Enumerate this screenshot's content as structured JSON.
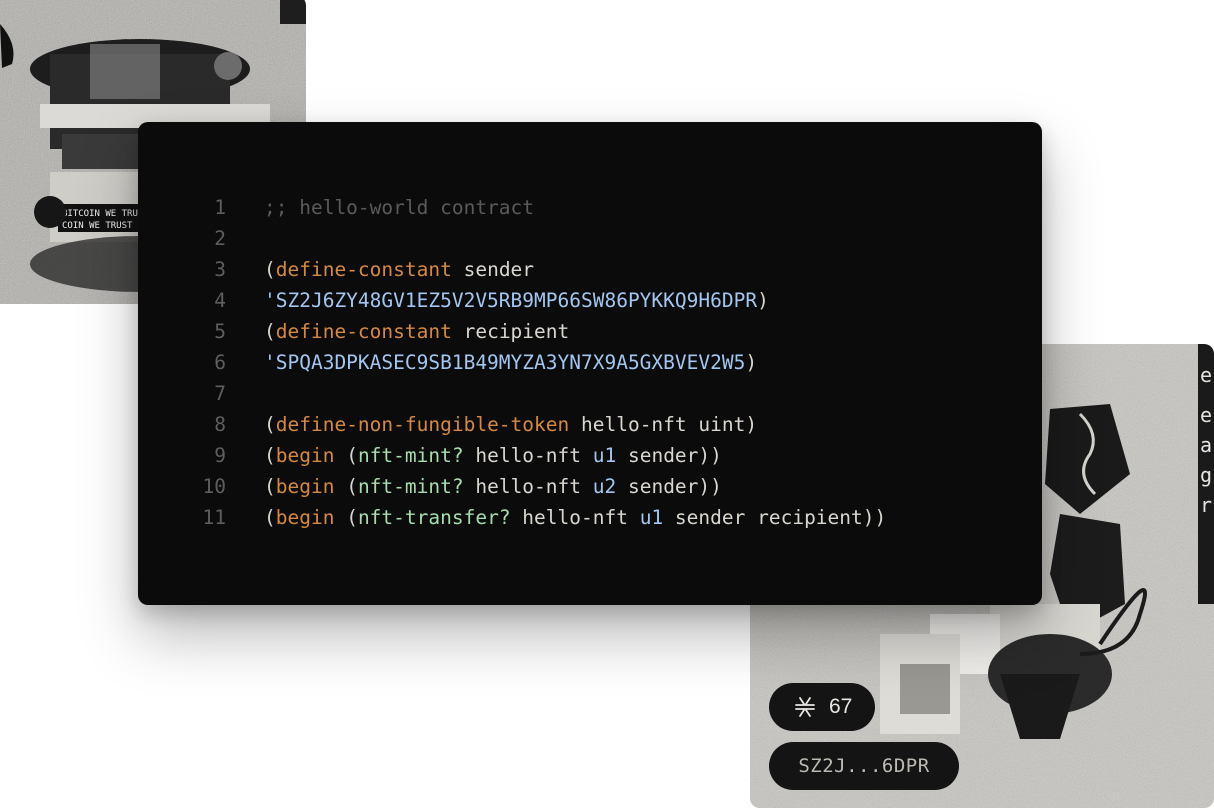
{
  "colors": {
    "background": "#ffffff",
    "code_background": "#0b0b0b",
    "line_number": "#5e5e5e",
    "comment": "#5a5a5a",
    "paren": "#d9d6cf",
    "keyword": "#d5893f",
    "function": "#a6dcae",
    "principal": "#a3c6f0",
    "plain": "#d9d6cf"
  },
  "code": {
    "lines": [
      {
        "n": "1",
        "tokens": [
          {
            "t": ";; hello-world contract",
            "c": "comment"
          }
        ]
      },
      {
        "n": "2",
        "tokens": []
      },
      {
        "n": "3",
        "tokens": [
          {
            "t": "(",
            "c": "paren"
          },
          {
            "t": "define-constant",
            "c": "keyword"
          },
          {
            "t": " sender",
            "c": "plain"
          }
        ]
      },
      {
        "n": "4",
        "tokens": [
          {
            "t": "'SZ2J6ZY48GV1EZ5V2V5RB9MP66SW86PYKKQ9H6DPR",
            "c": "principal"
          },
          {
            "t": ")",
            "c": "paren"
          }
        ]
      },
      {
        "n": "5",
        "tokens": [
          {
            "t": "(",
            "c": "paren"
          },
          {
            "t": "define-constant",
            "c": "keyword"
          },
          {
            "t": " recipient",
            "c": "plain"
          }
        ]
      },
      {
        "n": "6",
        "tokens": [
          {
            "t": "'SPQA3DPKASEC9SB1B49MYZA3YN7X9A5GXBVEV2W5",
            "c": "principal"
          },
          {
            "t": ")",
            "c": "paren"
          }
        ]
      },
      {
        "n": "7",
        "tokens": []
      },
      {
        "n": "8",
        "tokens": [
          {
            "t": "(",
            "c": "paren"
          },
          {
            "t": "define-non-fungible-token",
            "c": "keyword"
          },
          {
            "t": " hello-nft uint)",
            "c": "plain"
          }
        ]
      },
      {
        "n": "9",
        "tokens": [
          {
            "t": "(",
            "c": "paren"
          },
          {
            "t": "begin",
            "c": "keyword"
          },
          {
            "t": " (",
            "c": "paren"
          },
          {
            "t": "nft-mint?",
            "c": "function"
          },
          {
            "t": " hello-nft ",
            "c": "plain"
          },
          {
            "t": "u1",
            "c": "principal"
          },
          {
            "t": " sender))",
            "c": "plain"
          }
        ]
      },
      {
        "n": "10",
        "tokens": [
          {
            "t": "(",
            "c": "paren"
          },
          {
            "t": "begin",
            "c": "keyword"
          },
          {
            "t": " (",
            "c": "paren"
          },
          {
            "t": "nft-mint?",
            "c": "function"
          },
          {
            "t": " hello-nft ",
            "c": "plain"
          },
          {
            "t": "u2",
            "c": "principal"
          },
          {
            "t": " sender))",
            "c": "plain"
          }
        ]
      },
      {
        "n": "11",
        "tokens": [
          {
            "t": "(",
            "c": "paren"
          },
          {
            "t": "begin",
            "c": "keyword"
          },
          {
            "t": " (",
            "c": "paren"
          },
          {
            "t": "nft-transfer?",
            "c": "function"
          },
          {
            "t": " hello-nft ",
            "c": "plain"
          },
          {
            "t": "u1",
            "c": "principal"
          },
          {
            "t": " sender recipient))",
            "c": "plain"
          }
        ]
      }
    ]
  },
  "top_art": {
    "text_lines": [
      "BITCOIN WE TRUST",
      "COIN WE TRUST"
    ]
  },
  "nft_card": {
    "icon": "stacks-icon",
    "count": "67",
    "address": "SZ2J...6DPR",
    "side_letters": [
      "e",
      "e",
      "a",
      "g",
      "r"
    ]
  }
}
